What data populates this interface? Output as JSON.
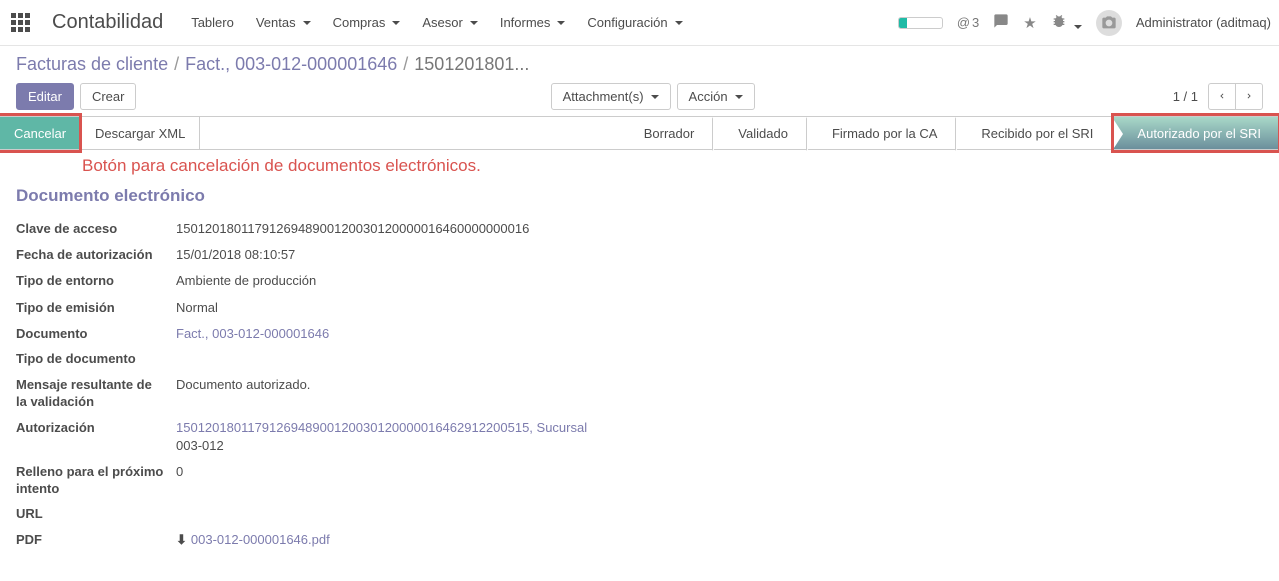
{
  "navbar": {
    "app_title": "Contabilidad",
    "menu": [
      {
        "label": "Tablero",
        "dropdown": false
      },
      {
        "label": "Ventas",
        "dropdown": true
      },
      {
        "label": "Compras",
        "dropdown": true
      },
      {
        "label": "Asesor",
        "dropdown": true
      },
      {
        "label": "Informes",
        "dropdown": true
      },
      {
        "label": "Configuración",
        "dropdown": true
      }
    ],
    "messages_count": "3",
    "username": "Administrator (aditmaq)"
  },
  "breadcrumb": {
    "items": [
      "Facturas de cliente",
      "Fact., 003-012-000001646"
    ],
    "active": "1501201801..."
  },
  "control_panel": {
    "edit_label": "Editar",
    "create_label": "Crear",
    "attachments_label": "Attachment(s)",
    "action_label": "Acción",
    "pager": "1 / 1"
  },
  "statusbar": {
    "cancel_label": "Cancelar",
    "download_xml_label": "Descargar XML",
    "steps": [
      "Borrador",
      "Validado",
      "Firmado por la CA",
      "Recibido por el SRI",
      "Autorizado por el SRI"
    ]
  },
  "annotation_text": "Botón para cancelación de documentos electrónicos.",
  "form": {
    "section_title": "Documento electrónico",
    "fields": {
      "clave_de_acceso": {
        "label": "Clave de acceso",
        "value": "1501201801179126948900120030120000016460000000016"
      },
      "fecha_autorizacion": {
        "label": "Fecha de autorización",
        "value": "15/01/2018 08:10:57"
      },
      "tipo_entorno": {
        "label": "Tipo de entorno",
        "value": "Ambiente de producción"
      },
      "tipo_emision": {
        "label": "Tipo de emisión",
        "value": "Normal"
      },
      "documento": {
        "label": "Documento",
        "value": "Fact., 003-012-000001646"
      },
      "tipo_documento": {
        "label": "Tipo de documento",
        "value": ""
      },
      "mensaje_validacion": {
        "label": "Mensaje resultante de la validación",
        "value": "Documento autorizado."
      },
      "autorizacion": {
        "label": "Autorización",
        "value_line1": "1501201801179126948900120030120000016462912200515, Sucursal",
        "value_line2": "003-012"
      },
      "relleno": {
        "label": "Relleno para el próximo intento",
        "value": "0"
      },
      "url": {
        "label": "URL",
        "value": ""
      },
      "pdf": {
        "label": "PDF",
        "value": "003-012-000001646.pdf"
      }
    }
  }
}
